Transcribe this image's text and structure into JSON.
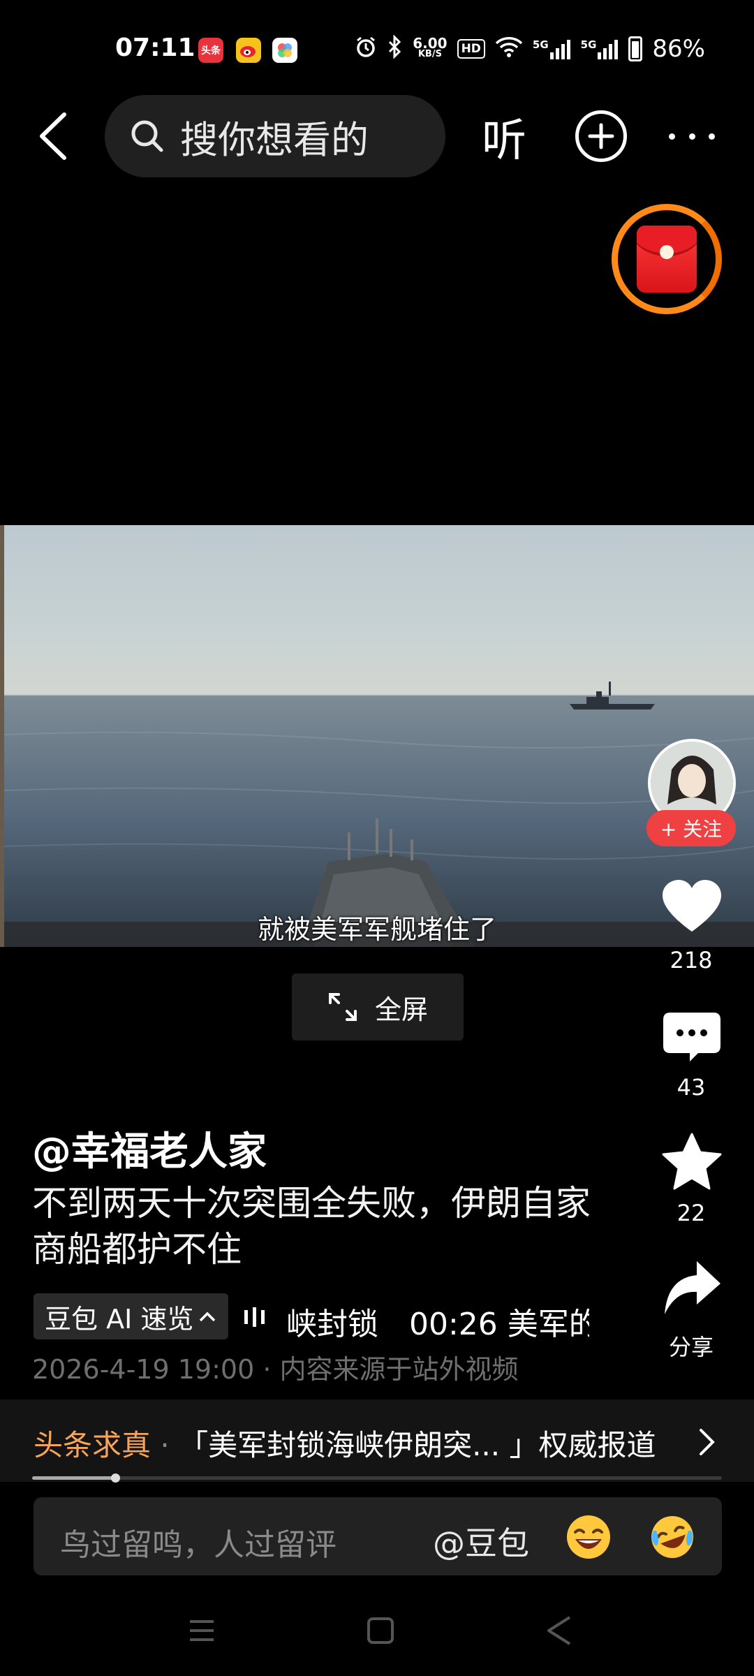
{
  "status_bar": {
    "time": "07:11",
    "apps": [
      {
        "name": "toutiao-app-icon",
        "label": "头条",
        "color": "#e8333c"
      },
      {
        "name": "weibo-app-icon",
        "label": "",
        "color": "#f7c21b"
      },
      {
        "name": "multicolor-app-icon",
        "label": "",
        "color": "#ffffff"
      }
    ],
    "net_speed_value": "6.00",
    "net_speed_unit": "KB/S",
    "hd_label": "HD",
    "signal_1": "5G",
    "signal_2": "5G",
    "battery": "86%"
  },
  "top_nav": {
    "search_placeholder": "搜你想看的",
    "listen_label": "听"
  },
  "video": {
    "subtitle": "就被美军军舰堵住了",
    "fullscreen_label": "全屏"
  },
  "right_rail": {
    "follow_label": "+ 关注",
    "likes": "218",
    "comments": "43",
    "favorites": "22",
    "share_label": "分享"
  },
  "post": {
    "author": "@幸福老人家",
    "title": "不到两天十次突围全失败，伊朗自家商船都护不住",
    "ai_chip_label": "豆包 AI 速览",
    "ai_summary": "峡封锁　00:26 美军的",
    "timestamp": "2026-4-19 19:00 · 内容来源于站外视频"
  },
  "fact_check": {
    "tag": "头条求真",
    "separator": " · ",
    "headline": "「美军封锁海峡伊朗突... 」权威报道",
    "progress": 0.12
  },
  "comment_bar": {
    "placeholder": "鸟过留鸣，人过留评",
    "mention": "@豆包"
  },
  "colors": {
    "accent_red": "#f04142",
    "accent_orange": "#f5a45a",
    "background": "#000000"
  }
}
